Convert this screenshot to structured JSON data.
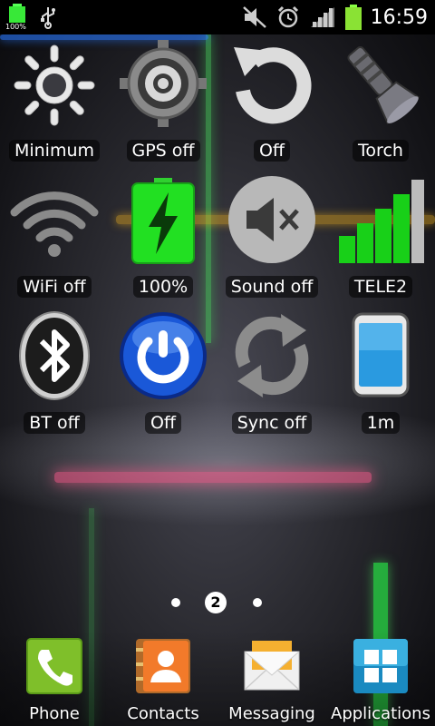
{
  "status_bar": {
    "battery_small_label": "100%",
    "time": "16:59",
    "icons": [
      "battery-icon",
      "usb-icon",
      "mute-icon",
      "alarm-icon",
      "signal-icon",
      "battery-full-icon"
    ]
  },
  "widgets": [
    {
      "label": "Minimum",
      "icon": "brightness-icon"
    },
    {
      "label": "GPS off",
      "icon": "gps-icon"
    },
    {
      "label": "Off",
      "icon": "rotate-icon"
    },
    {
      "label": "Torch",
      "icon": "torch-icon"
    },
    {
      "label": "WiFi off",
      "icon": "wifi-icon"
    },
    {
      "label": "100%",
      "icon": "battery-charging-icon"
    },
    {
      "label": "Sound off",
      "icon": "speaker-mute-icon"
    },
    {
      "label": "TELE2",
      "icon": "signal-bars-icon"
    },
    {
      "label": "BT off",
      "icon": "bluetooth-icon"
    },
    {
      "label": "Off",
      "icon": "power-icon"
    },
    {
      "label": "Sync off",
      "icon": "sync-icon"
    },
    {
      "label": "1m",
      "icon": "screen-timeout-icon"
    }
  ],
  "pager": {
    "current_page": "2"
  },
  "dock": [
    {
      "label": "Phone",
      "icon": "phone-icon"
    },
    {
      "label": "Contacts",
      "icon": "contacts-icon"
    },
    {
      "label": "Messaging",
      "icon": "messaging-icon"
    },
    {
      "label": "Applications",
      "icon": "apps-grid-icon"
    }
  ],
  "colors": {
    "accent_green": "#1fe01f",
    "blue": "#1a58d8",
    "status_bg": "#000000"
  }
}
